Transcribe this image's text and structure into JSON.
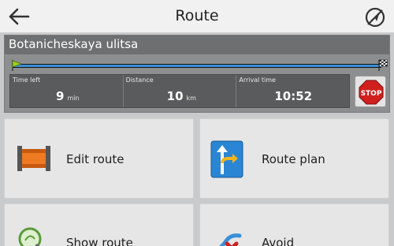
{
  "header": {
    "title": "Route",
    "back_icon": "arrow-left-icon",
    "gps_icon": "no-gps-icon"
  },
  "route": {
    "street": "Botanicheskaya ulitsa",
    "progress": 1.0,
    "stats": [
      {
        "label": "Time left",
        "value": "9",
        "unit": "min"
      },
      {
        "label": "Distance",
        "value": "10",
        "unit": "km"
      },
      {
        "label": "Arrival time",
        "value": "10:52",
        "unit": ""
      }
    ],
    "stop_label": "STOP"
  },
  "menu": {
    "items": [
      {
        "label": "Edit route",
        "icon": "route-edit-icon"
      },
      {
        "label": "Route plan",
        "icon": "route-plan-icon"
      },
      {
        "label": "Show route",
        "icon": "magnifier-icon"
      },
      {
        "label": "Avoid",
        "icon": "avoid-icon"
      }
    ]
  },
  "colors": {
    "header_bg": "#f1f1f1",
    "panel_bg": "#8d8e8f",
    "progress": "#3a8fd8",
    "stop_red": "#d0201e",
    "tile_bg": "#e6e6e6"
  }
}
